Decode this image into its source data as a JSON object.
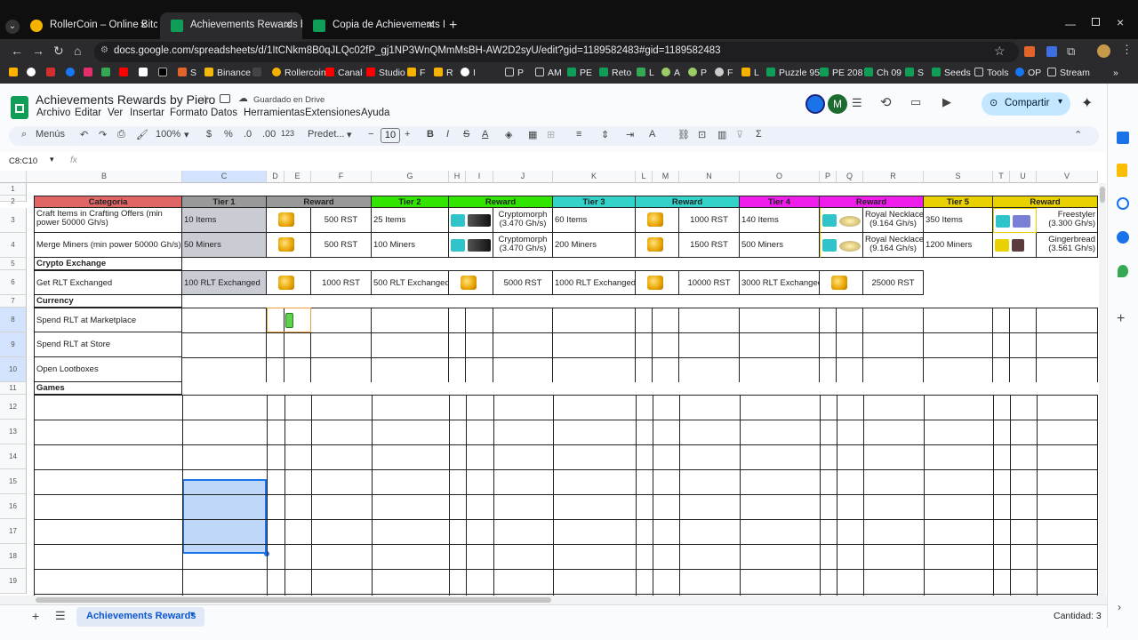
{
  "browser": {
    "tabs": [
      {
        "title": "RollerCoin – Online Bitcoin Mi",
        "icon_color": "#f5b300",
        "active": false
      },
      {
        "title": "Achievements Rewards by Piero",
        "icon_color": "#0f9d58",
        "active": true
      },
      {
        "title": "Copia de Achievements Reward",
        "icon_color": "#0f9d58",
        "active": false
      }
    ],
    "url": "docs.google.com/spreadsheets/d/1ItCNkm8B0qJLQc02fP_gj1NP3WnQMmMsBH-AW2D2syU/edit?gid=1189582483#gid=1189582483",
    "bookmarks": [
      "S",
      "Binance",
      "Rollercoin",
      "Canal",
      "Studio",
      "F",
      "R",
      "I",
      "P",
      "AM",
      "PE",
      "Reto",
      "L",
      "A",
      "P",
      "F",
      "L",
      "Puzzle 95",
      "PE 208",
      "Ch 09",
      "S",
      "Seeds",
      "Tools",
      "OP",
      "Stream"
    ]
  },
  "sheet": {
    "title": "Achievements Rewards by Piero",
    "saved_status": "Guardado en Drive",
    "menus": [
      "Archivo",
      "Editar",
      "Ver",
      "Insertar",
      "Formato",
      "Datos",
      "Herramientas",
      "Extensiones",
      "Ayuda"
    ],
    "share_label": "Compartir",
    "avatar_letter": "M",
    "toolbar": {
      "menus_label": "Menús",
      "zoom": "100%",
      "currency": "$",
      "percent": "%",
      "dec_less": ".0",
      "dec_more": ".00",
      "num_format": "123",
      "font": "Predet...",
      "font_size": "10"
    },
    "name_box": "C8:C10",
    "fx": "fx",
    "columns": [
      "B",
      "C",
      "D",
      "E",
      "F",
      "G",
      "H",
      "I",
      "J",
      "K",
      "L",
      "M",
      "N",
      "O",
      "P",
      "Q",
      "R",
      "S",
      "T",
      "U",
      "V"
    ],
    "headers": {
      "categoria": "Categoria",
      "tier1": "Tier 1",
      "reward1": "Reward",
      "tier2": "Tier 2",
      "reward2": "Reward",
      "tier3": "Tier 3",
      "reward3": "Reward",
      "tier4": "Tier 4",
      "reward4": "Reward",
      "tier5": "Tier 5",
      "reward5": "Reward"
    },
    "rows": {
      "r3": {
        "cat": "Craft Items in Crafting Offers (min power 50000 Gh/s)",
        "t1": "10 Items",
        "r1": "500 RST",
        "t2": "25 Items",
        "r2a": "Cryptomorph",
        "r2b": "(3.470 Gh/s)",
        "t3": "60 Items",
        "r3": "1000 RST",
        "t4": "140 Items",
        "r4a": "Royal Necklace",
        "r4b": "(9.164 Gh/s)",
        "t5": "350 Items",
        "r5a": "Freestyler",
        "r5b": "(3.300 Gh/s)"
      },
      "r4": {
        "cat": "Merge Miners (min power 50000 Gh/s)",
        "t1": "50 Miners",
        "r1": "500 RST",
        "t2": "100 Miners",
        "r2a": "Cryptomorph",
        "r2b": "(3.470 Gh/s)",
        "t3": "200 Miners",
        "r3": "1500 RST",
        "t4": "500 Miners",
        "r4a": "Royal Necklace",
        "r4b": "(9.164 Gh/s)",
        "t5": "1200 Miners",
        "r5a": "Gingerbread",
        "r5b": "(3.561 Gh/s)"
      },
      "r5": {
        "cat": "Crypto Exchange"
      },
      "r6": {
        "cat": "Get RLT Exchanged",
        "t1": "100 RLT Exchanged",
        "r1": "1000 RST",
        "t2": "500 RLT Exchanged",
        "r2": "5000 RST",
        "t3": "1000 RLT Exchanged",
        "r3": "10000 RST",
        "t4": "3000 RLT Exchanged",
        "r4": "25000 RST"
      },
      "r7": {
        "cat": "Currency"
      },
      "r8": {
        "cat": "Spend RLT at Marketplace"
      },
      "r9": {
        "cat": "Spend RLT at Store"
      },
      "r10": {
        "cat": "Open Lootboxes"
      },
      "r11": {
        "cat": "Games"
      }
    },
    "row_numbers": [
      "1",
      "2",
      "3",
      "4",
      "5",
      "6",
      "7",
      "8",
      "9",
      "10",
      "11",
      "12",
      "13",
      "14",
      "15",
      "16",
      "17",
      "18",
      "19"
    ],
    "sheet_tab": "Achievements Rewards",
    "count_label": "Cantidad: 3",
    "colors": {
      "red": "#e06666",
      "gray": "#999999",
      "green": "#31e500",
      "cyan": "#34d3c9",
      "magenta": "#ee1de9",
      "yellow": "#e9d100",
      "lightred": "#ea9999"
    }
  }
}
